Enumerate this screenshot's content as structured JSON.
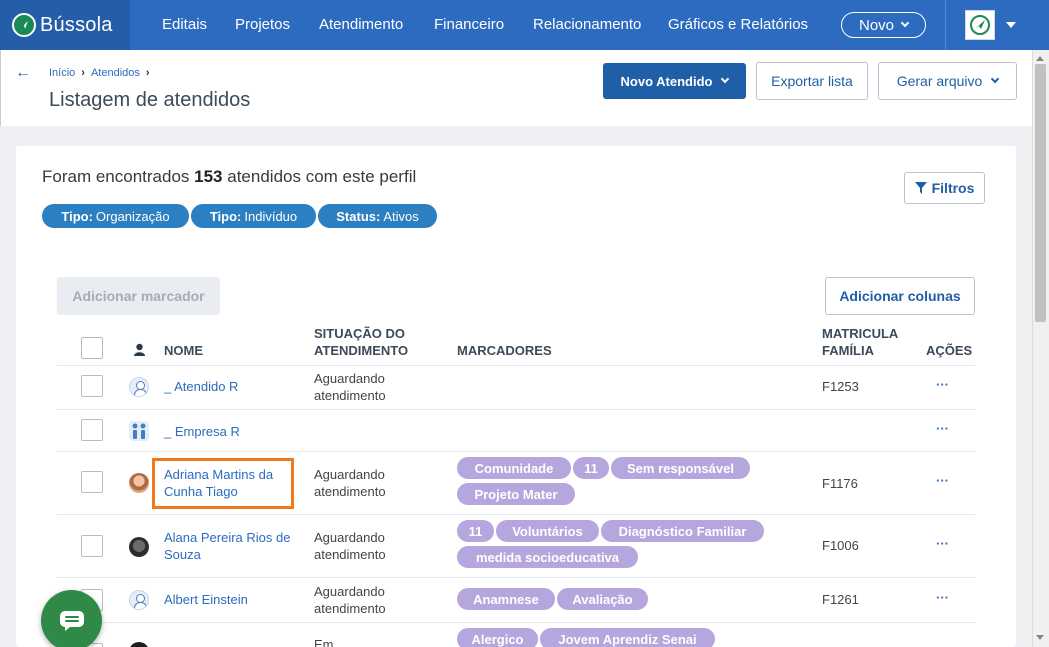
{
  "brand": {
    "name": "Bússola"
  },
  "nav": {
    "items": [
      "Editais",
      "Projetos",
      "Atendimento",
      "Financeiro",
      "Relacionamento",
      "Gráficos e Relatórios"
    ],
    "novo_label": "Novo"
  },
  "breadcrumb": {
    "home": "Início",
    "current": "Atendidos"
  },
  "page": {
    "title": "Listagem de atendidos"
  },
  "actions": {
    "new_label": "Novo Atendido",
    "export_label": "Exportar lista",
    "generate_label": "Gerar arquivo"
  },
  "summary": {
    "prefix": "Foram encontrados",
    "count": "153",
    "suffix": "atendidos com este perfil"
  },
  "filters_label": "Filtros",
  "chips": [
    {
      "key": "Tipo:",
      "value": "Organização"
    },
    {
      "key": "Tipo:",
      "value": "Indivíduo"
    },
    {
      "key": "Status:",
      "value": "Ativos"
    }
  ],
  "table": {
    "add_marker_label": "Adicionar marcador",
    "add_columns_label": "Adicionar colunas",
    "headers": {
      "name": "NOME",
      "status_line1": "SITUAÇÃO DO",
      "status_line2": "ATENDIMENTO",
      "markers": "MARCADORES",
      "matricula_line1": "MATRICULA",
      "matricula_line2": "FAMÍLIA",
      "actions": "AÇÕES"
    },
    "rows": [
      {
        "name1": "_ Atendido R",
        "name2": "",
        "status1": "Aguardando",
        "status2": "atendimento",
        "tags": [],
        "matricula": "F1253",
        "actions": "···"
      },
      {
        "name1": "_ Empresa R",
        "name2": "",
        "status1": "",
        "status2": "",
        "tags": [],
        "matricula": "",
        "actions": "···"
      },
      {
        "name1": "Adriana Martins da",
        "name2": "Cunha Tiago",
        "status1": "Aguardando",
        "status2": "atendimento",
        "tags": [
          "Comunidade",
          "11",
          "Sem responsável",
          "Projeto Mater"
        ],
        "matricula": "F1176",
        "actions": "···"
      },
      {
        "name1": "Alana Pereira Rios de",
        "name2": "Souza",
        "status1": "Aguardando",
        "status2": "atendimento",
        "tags": [
          "11",
          "Voluntários",
          "Diagnóstico Familiar",
          "medida socioeducativa"
        ],
        "matricula": "F1006",
        "actions": "···"
      },
      {
        "name1": "Albert Einstein",
        "name2": "",
        "status1": "Aguardando",
        "status2": "atendimento",
        "tags": [
          "Anamnese",
          "Avaliação"
        ],
        "matricula": "F1261",
        "actions": "···"
      },
      {
        "name1": "",
        "name2": "",
        "status1": "Em",
        "status2": "",
        "tags": [
          "Alergico",
          "Jovem Aprendiz Senai"
        ],
        "matricula": "",
        "actions": ""
      }
    ]
  },
  "colors": {
    "nav": "#2c6bbf",
    "primary": "#1f5fa8",
    "chip": "#2c7fc0",
    "tag": "#b5a6dd",
    "highlight": "#f07a1a",
    "chat": "#2f8a47"
  }
}
